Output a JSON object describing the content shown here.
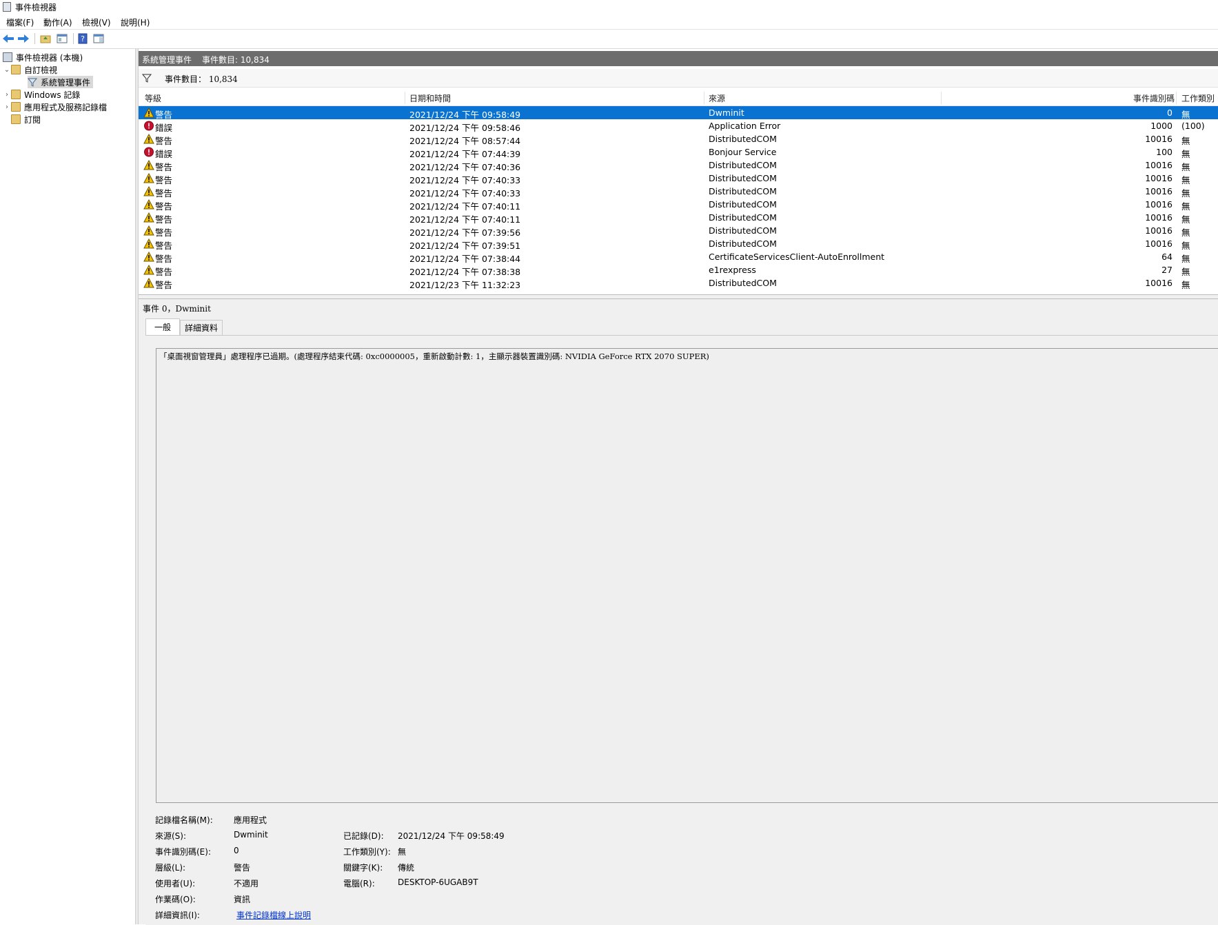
{
  "window": {
    "title": "事件檢視器"
  },
  "menu": [
    {
      "label": "檔案(F)"
    },
    {
      "label": "動作(A)"
    },
    {
      "label": "檢視(V)"
    },
    {
      "label": "說明(H)"
    }
  ],
  "toolbar": {
    "icons": [
      "back-icon",
      "forward-icon",
      "folder-up-icon",
      "properties-icon",
      "help-icon",
      "show-pane-icon"
    ]
  },
  "tree": {
    "root": "事件檢視器 (本機)",
    "custom_views": "自訂檢視",
    "admin_events": "系統管理事件",
    "windows_logs": "Windows 記錄",
    "app_service_logs": "應用程式及服務記錄檔",
    "subscriptions": "訂閱"
  },
  "header": {
    "title": "系統管理事件",
    "count": "事件數目: 10,834"
  },
  "filter": {
    "label": "事件數目： 10,834"
  },
  "columns": {
    "level": "等級",
    "datetime": "日期和時間",
    "source": "來源",
    "event_id": "事件識別碼",
    "task": "工作類別"
  },
  "colors": {
    "selection": "#0a73d1",
    "header_bar": "#6d6d6d",
    "warning": "#f2c200",
    "error": "#c8102e",
    "link": "#0033cc"
  },
  "events": [
    {
      "level": "警告",
      "type": "warning",
      "datetime": "2021/12/24 下午 09:58:49",
      "source": "Dwminit",
      "id": "0",
      "task": "無"
    },
    {
      "level": "錯誤",
      "type": "error",
      "datetime": "2021/12/24 下午 09:58:46",
      "source": "Application Error",
      "id": "1000",
      "task": "(100)"
    },
    {
      "level": "警告",
      "type": "warning",
      "datetime": "2021/12/24 下午 08:57:44",
      "source": "DistributedCOM",
      "id": "10016",
      "task": "無"
    },
    {
      "level": "錯誤",
      "type": "error",
      "datetime": "2021/12/24 下午 07:44:39",
      "source": "Bonjour Service",
      "id": "100",
      "task": "無"
    },
    {
      "level": "警告",
      "type": "warning",
      "datetime": "2021/12/24 下午 07:40:36",
      "source": "DistributedCOM",
      "id": "10016",
      "task": "無"
    },
    {
      "level": "警告",
      "type": "warning",
      "datetime": "2021/12/24 下午 07:40:33",
      "source": "DistributedCOM",
      "id": "10016",
      "task": "無"
    },
    {
      "level": "警告",
      "type": "warning",
      "datetime": "2021/12/24 下午 07:40:33",
      "source": "DistributedCOM",
      "id": "10016",
      "task": "無"
    },
    {
      "level": "警告",
      "type": "warning",
      "datetime": "2021/12/24 下午 07:40:11",
      "source": "DistributedCOM",
      "id": "10016",
      "task": "無"
    },
    {
      "level": "警告",
      "type": "warning",
      "datetime": "2021/12/24 下午 07:40:11",
      "source": "DistributedCOM",
      "id": "10016",
      "task": "無"
    },
    {
      "level": "警告",
      "type": "warning",
      "datetime": "2021/12/24 下午 07:39:56",
      "source": "DistributedCOM",
      "id": "10016",
      "task": "無"
    },
    {
      "level": "警告",
      "type": "warning",
      "datetime": "2021/12/24 下午 07:39:51",
      "source": "DistributedCOM",
      "id": "10016",
      "task": "無"
    },
    {
      "level": "警告",
      "type": "warning",
      "datetime": "2021/12/24 下午 07:38:44",
      "source": "CertificateServicesClient-AutoEnrollment",
      "id": "64",
      "task": "無"
    },
    {
      "level": "警告",
      "type": "warning",
      "datetime": "2021/12/24 下午 07:38:38",
      "source": "e1rexpress",
      "id": "27",
      "task": "無"
    },
    {
      "level": "警告",
      "type": "warning",
      "datetime": "2021/12/23 下午 11:32:23",
      "source": "DistributedCOM",
      "id": "10016",
      "task": "無"
    }
  ],
  "detail": {
    "title": "事件 0，Dwminit",
    "tab_general": "一般",
    "tab_details": "詳細資料",
    "description": "「桌面視窗管理員」處理程序已過期。(處理程序結束代碼: 0xc0000005，重新啟動計數: 1，主顯示器裝置識別碼: NVIDIA GeForce RTX 2070 SUPER)",
    "props": {
      "log_name_label": "記錄檔名稱(M):",
      "log_name": "應用程式",
      "source_label": "來源(S):",
      "source": "Dwminit",
      "logged_label": "已記錄(D):",
      "logged": "2021/12/24 下午 09:58:49",
      "event_id_label": "事件識別碼(E):",
      "event_id": "0",
      "task_label": "工作類別(Y):",
      "task": "無",
      "level_label": "層級(L):",
      "level": "警告",
      "keywords_label": "關鍵字(K):",
      "keywords": "傳統",
      "user_label": "使用者(U):",
      "user": "不適用",
      "computer_label": "電腦(R):",
      "computer": "DESKTOP-6UGAB9T",
      "opcode_label": "作業碼(O):",
      "opcode": "資訊",
      "more_info_label": "詳細資訊(I):",
      "more_info": "事件記錄檔線上說明"
    }
  }
}
